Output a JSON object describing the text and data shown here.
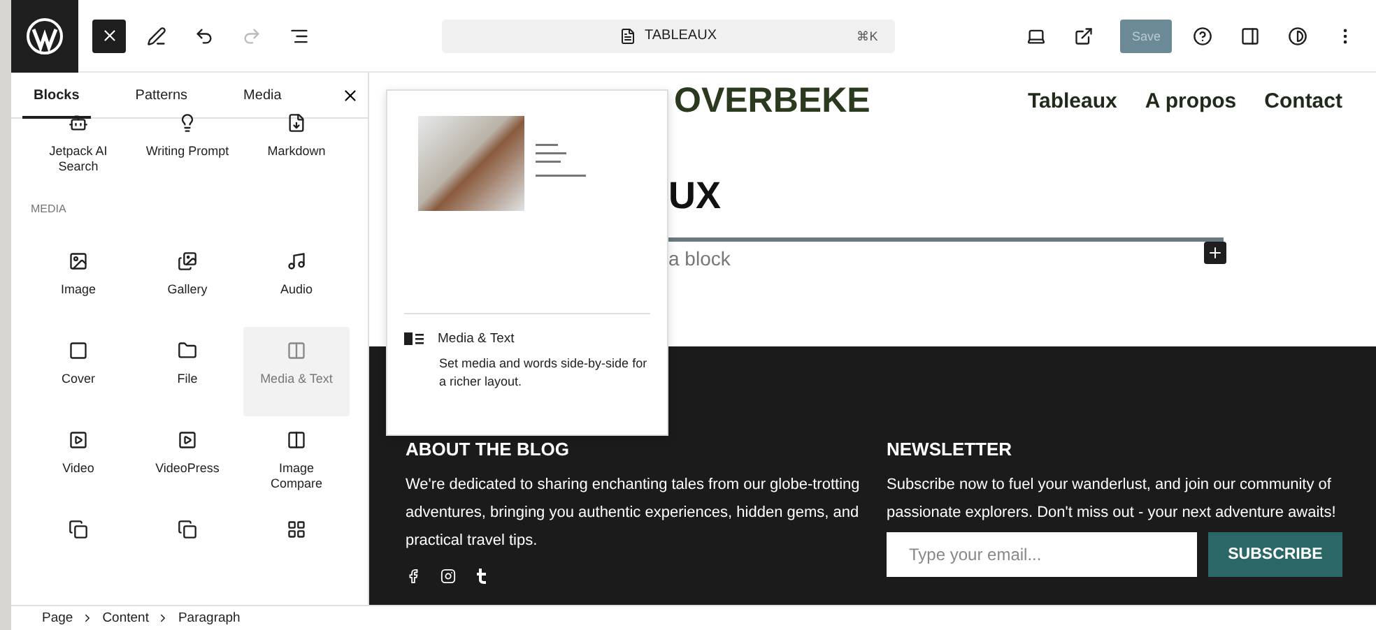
{
  "toolbar": {
    "document_title": "TABLEAUX",
    "shortcut": "⌘K",
    "redo": {
      "disabled": true
    },
    "save": {
      "label": "Save",
      "disabled": true
    }
  },
  "inserter": {
    "tabs": [
      {
        "label": "Blocks",
        "selected": true
      },
      {
        "label": "Patterns",
        "selected": false
      },
      {
        "label": "Media",
        "selected": false
      }
    ],
    "top_blocks": [
      {
        "label": "Jetpack AI Search"
      },
      {
        "label": "Writing Prompt"
      },
      {
        "label": "Markdown"
      }
    ],
    "media_heading": "MEDIA",
    "media_blocks": [
      {
        "label": "Image",
        "selected": false
      },
      {
        "label": "Gallery",
        "selected": false
      },
      {
        "label": "Audio",
        "selected": false
      },
      {
        "label": "Cover",
        "selected": false
      },
      {
        "label": "File",
        "selected": false
      },
      {
        "label": "Media & Text",
        "selected": true
      },
      {
        "label": "Video",
        "selected": false
      },
      {
        "label": "VideoPress",
        "selected": false
      },
      {
        "label": "Image Compare",
        "selected": false
      }
    ]
  },
  "preview": {
    "title": "Media & Text",
    "description": "Set media and words side-by-side for a richer layout."
  },
  "site": {
    "title": "OVERBEKE",
    "nav": [
      "Tableaux",
      "A propos",
      "Contact"
    ],
    "page_title": "UX",
    "paragraph_placeholder": "a block"
  },
  "footer": {
    "about": {
      "heading": "ABOUT THE BLOG",
      "text": "We're dedicated to sharing enchanting tales from our globe-trotting adventures, bringing you authentic experiences, hidden gems, and practical travel tips."
    },
    "newsletter": {
      "heading": "NEWSLETTER",
      "text": "Subscribe now to fuel your wanderlust, and join our community of passionate explorers. Don't miss out - your next adventure awaits!",
      "email_placeholder": "Type your email...",
      "button": "SUBSCRIBE"
    }
  },
  "breadcrumb": [
    "Page",
    "Content",
    "Paragraph"
  ]
}
